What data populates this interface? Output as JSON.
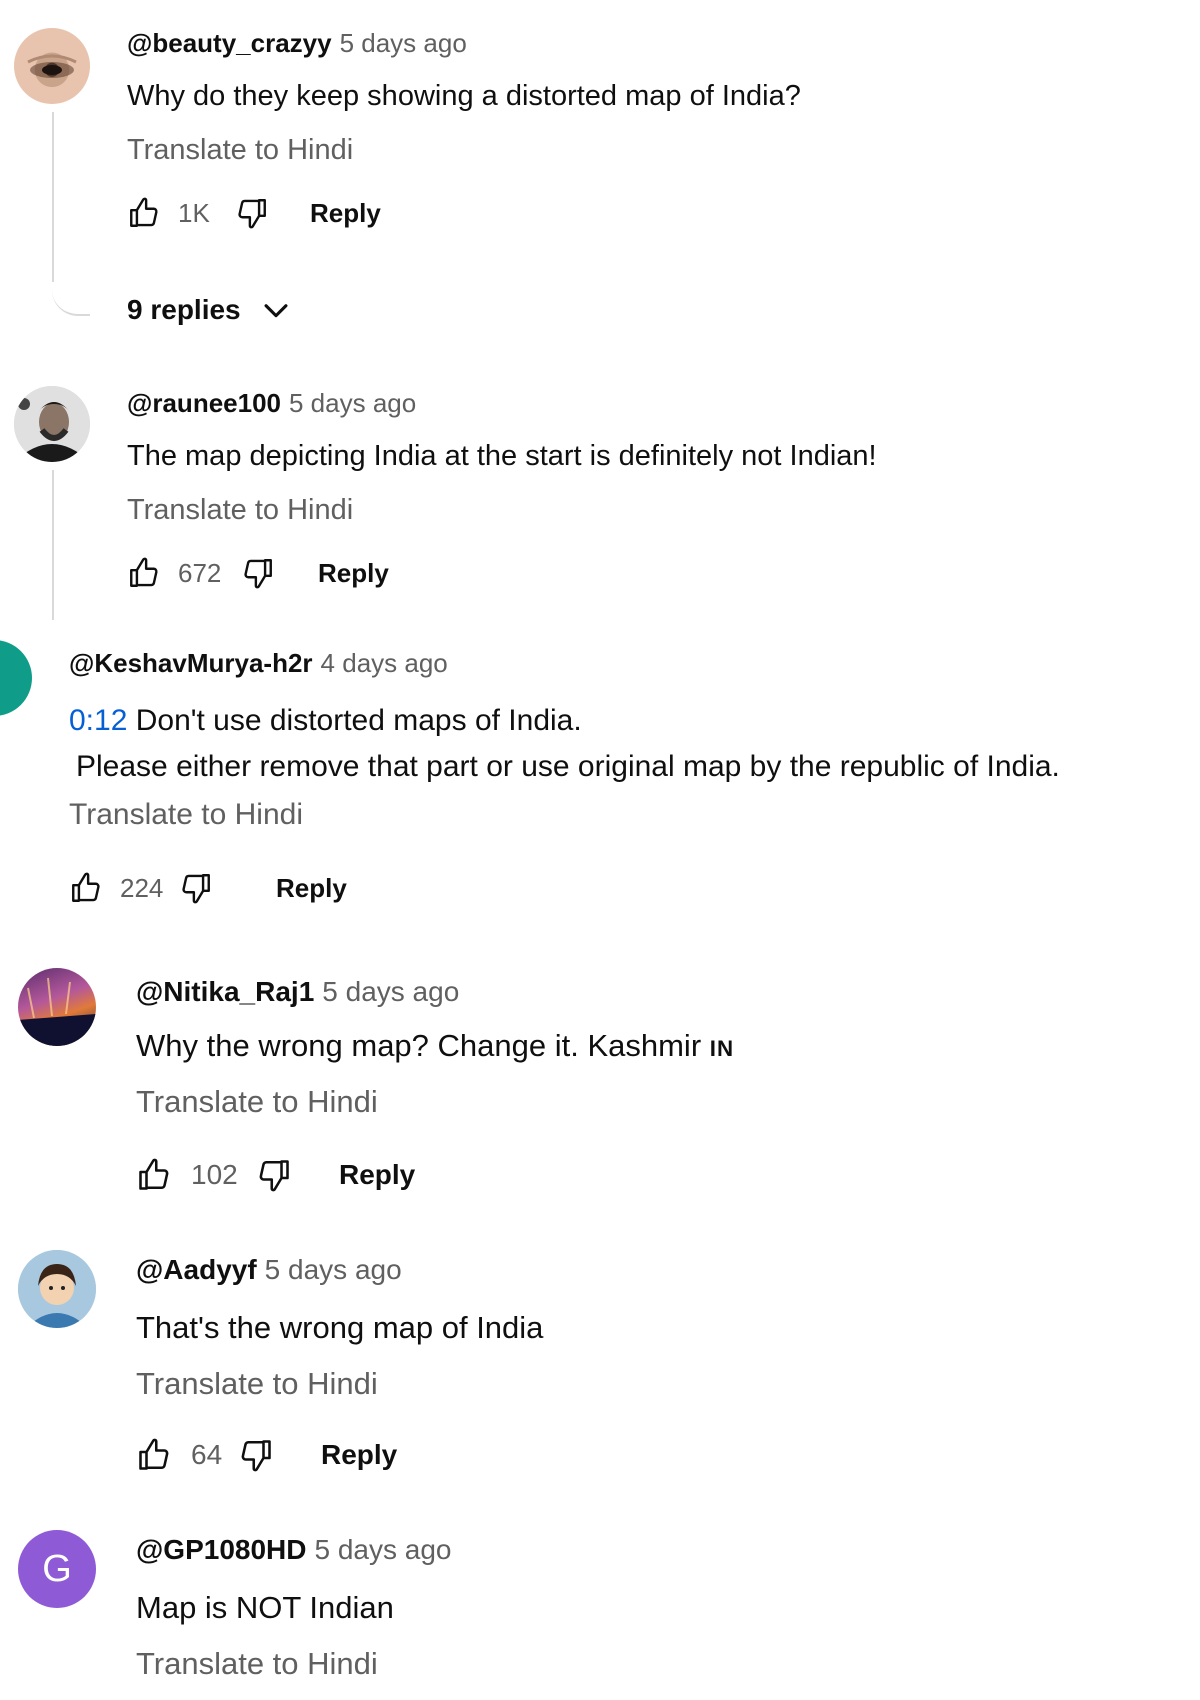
{
  "comments": [
    {
      "author": "@beauty_crazyy",
      "time": "5 days ago",
      "text": "Why do they keep showing a distorted map of India?",
      "translate": "Translate to Hindi",
      "likes": "1K",
      "reply": "Reply",
      "replies_label": "9 replies"
    },
    {
      "author": "@raunee100",
      "time": "5 days ago",
      "text": "The map depicting India at the start is definitely not Indian!",
      "translate": "Translate to Hindi",
      "likes": "672",
      "reply": "Reply"
    },
    {
      "author": "@KeshavMurya-h2r",
      "time": "4 days ago",
      "timestamp_link": "0:12",
      "text_line1": " Don't use distorted maps of India.",
      "text_line2": "Please either remove that part or use original map by the republic of India.",
      "translate": "Translate to Hindi",
      "likes": "224",
      "reply": "Reply"
    },
    {
      "author": "@Nitika_Raj1",
      "time": "5 days ago",
      "text": "Why the wrong map? Change it. Kashmir ",
      "text_suffix": "IN",
      "translate": "Translate to Hindi",
      "likes": "102",
      "reply": "Reply"
    },
    {
      "author": "@Aadyyf",
      "time": "5 days ago",
      "text": "That's the wrong map of India",
      "translate": "Translate to Hindi",
      "likes": "64",
      "reply": "Reply"
    },
    {
      "author": "@GP1080HD",
      "time": "5 days ago",
      "avatar_letter": "G",
      "text": "Map is NOT Indian",
      "translate": "Translate to Hindi"
    }
  ],
  "colors": {
    "link": "#065fd4",
    "secondary_text": "#606060",
    "avatar_teal": "#0f9d8a",
    "avatar_purple": "#8e5ad6"
  },
  "icons": [
    "thumb-up-icon",
    "thumb-down-icon",
    "chevron-down-icon"
  ]
}
